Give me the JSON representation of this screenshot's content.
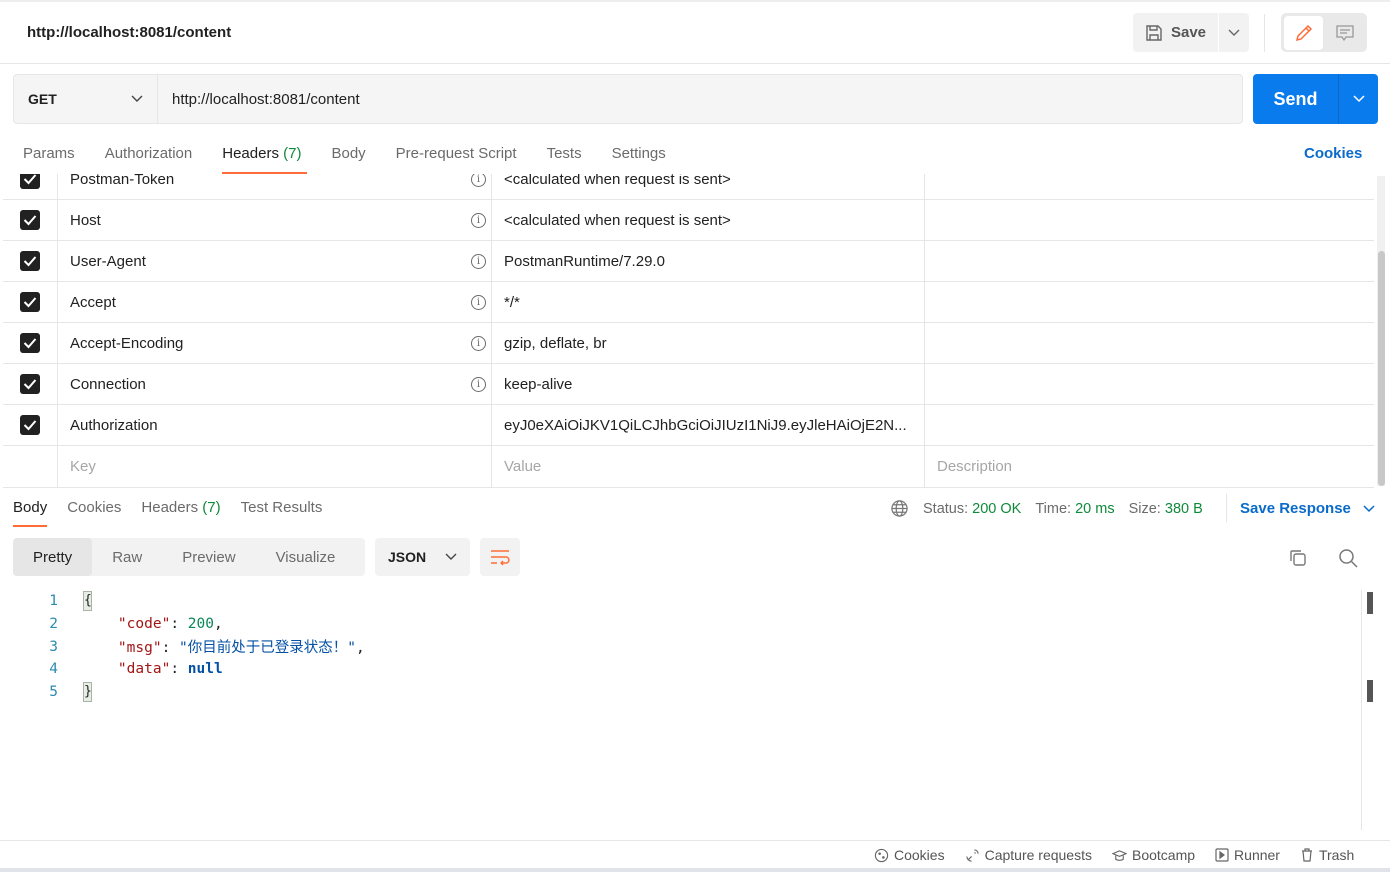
{
  "header": {
    "title": "http://localhost:8081/content",
    "save_label": "Save"
  },
  "request": {
    "method": "GET",
    "url": "http://localhost:8081/content",
    "send_label": "Send"
  },
  "tabs": [
    {
      "label": "Params"
    },
    {
      "label": "Authorization"
    },
    {
      "label": "Headers",
      "count": "(7)",
      "active": true
    },
    {
      "label": "Body"
    },
    {
      "label": "Pre-request Script"
    },
    {
      "label": "Tests"
    },
    {
      "label": "Settings"
    }
  ],
  "cookies_link": "Cookies",
  "headers": [
    {
      "key": "Postman-Token",
      "value": "<calculated when request is sent>",
      "info": true
    },
    {
      "key": "Host",
      "value": "<calculated when request is sent>",
      "info": true
    },
    {
      "key": "User-Agent",
      "value": "PostmanRuntime/7.29.0",
      "info": true
    },
    {
      "key": "Accept",
      "value": "*/*",
      "info": true
    },
    {
      "key": "Accept-Encoding",
      "value": "gzip, deflate, br",
      "info": true
    },
    {
      "key": "Connection",
      "value": "keep-alive",
      "info": true
    },
    {
      "key": "Authorization",
      "value": "eyJ0eXAiOiJKV1QiLCJhbGciOiJIUzI1NiJ9.eyJleHAiOjE2N...",
      "info": false
    }
  ],
  "placeholders": {
    "key": "Key",
    "value": "Value",
    "description": "Description"
  },
  "response": {
    "tabs": [
      {
        "label": "Body"
      },
      {
        "label": "Cookies"
      },
      {
        "label": "Headers",
        "count": "(7)"
      },
      {
        "label": "Test Results"
      }
    ],
    "status_label": "Status:",
    "status": "200 OK",
    "time_label": "Time:",
    "time": "20 ms",
    "size_label": "Size:",
    "size": "380 B",
    "save_response": "Save Response",
    "formats": [
      "Pretty",
      "Raw",
      "Preview",
      "Visualize"
    ],
    "language": "JSON",
    "lines": [
      "1",
      "2",
      "3",
      "4",
      "5"
    ],
    "body": {
      "code_key": "\"code\"",
      "code_val": "200",
      "msg_key": "\"msg\"",
      "msg_val": "\"你目前处于已登录状态！\"",
      "data_key": "\"data\"",
      "data_val": "null"
    }
  },
  "footer": [
    "Cookies",
    "Capture requests",
    "Bootcamp",
    "Runner",
    "Trash"
  ],
  "colors": {
    "accent": "#ff6c37",
    "send": "#097bed",
    "link": "#0b6bcb",
    "status_ok": "#0f8a3b"
  }
}
